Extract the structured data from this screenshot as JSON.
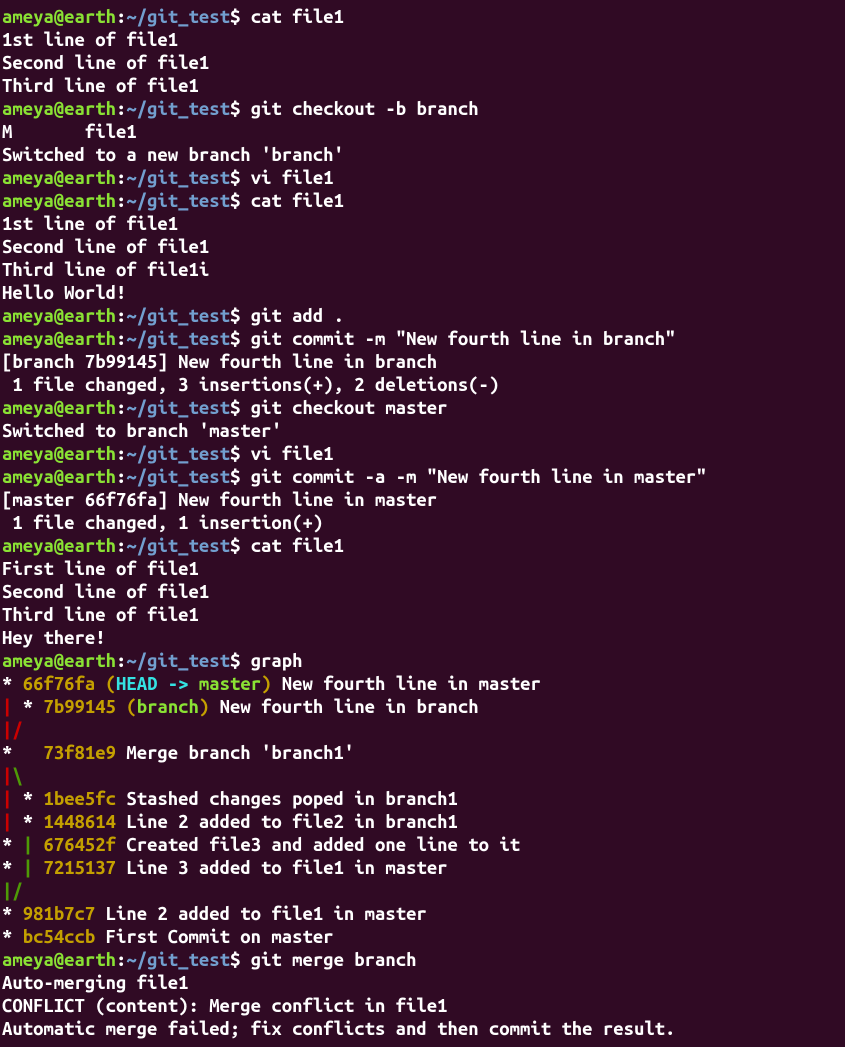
{
  "prompt": {
    "user": "ameya@earth",
    "colon": ":",
    "path": "~/git_test",
    "dollar": "$ "
  },
  "lines": [
    {
      "t": "prompt",
      "cmd": "cat file1"
    },
    {
      "t": "out",
      "text": "1st line of file1"
    },
    {
      "t": "out",
      "text": "Second line of file1"
    },
    {
      "t": "out",
      "text": "Third line of file1"
    },
    {
      "t": "prompt",
      "cmd": "git checkout -b branch"
    },
    {
      "t": "out",
      "text": "M       file1"
    },
    {
      "t": "out",
      "text": "Switched to a new branch 'branch'"
    },
    {
      "t": "prompt",
      "cmd": "vi file1"
    },
    {
      "t": "prompt",
      "cmd": "cat file1"
    },
    {
      "t": "out",
      "text": "1st line of file1"
    },
    {
      "t": "out",
      "text": "Second line of file1"
    },
    {
      "t": "out",
      "text": "Third line of file1i"
    },
    {
      "t": "out",
      "text": "Hello World!"
    },
    {
      "t": "prompt",
      "cmd": "git add ."
    },
    {
      "t": "prompt",
      "cmd": "git commit -m \"New fourth line in branch\""
    },
    {
      "t": "out",
      "text": "[branch 7b99145] New fourth line in branch"
    },
    {
      "t": "out",
      "text": " 1 file changed, 3 insertions(+), 2 deletions(-)"
    },
    {
      "t": "prompt",
      "cmd": "git checkout master"
    },
    {
      "t": "out",
      "text": "Switched to branch 'master'"
    },
    {
      "t": "prompt",
      "cmd": "vi file1"
    },
    {
      "t": "prompt",
      "cmd": "git commit -a -m \"New fourth line in master\""
    },
    {
      "t": "out",
      "text": "[master 66f76fa] New fourth line in master"
    },
    {
      "t": "out",
      "text": " 1 file changed, 1 insertion(+)"
    },
    {
      "t": "prompt",
      "cmd": "cat file1"
    },
    {
      "t": "out",
      "text": "First line of file1"
    },
    {
      "t": "out",
      "text": "Second line of file1"
    },
    {
      "t": "out",
      "text": "Third line of file1"
    },
    {
      "t": "out",
      "text": "Hey there!"
    },
    {
      "t": "prompt",
      "cmd": "graph"
    },
    {
      "t": "graph",
      "segs": [
        {
          "c": "graph-white",
          "v": "* "
        },
        {
          "c": "hash",
          "v": "66f76fa "
        },
        {
          "c": "paren-yellow",
          "v": "("
        },
        {
          "c": "head",
          "v": "HEAD -> "
        },
        {
          "c": "branchname",
          "v": "master"
        },
        {
          "c": "paren-yellow",
          "v": ")"
        },
        {
          "c": "out",
          "v": " New fourth line in master"
        }
      ]
    },
    {
      "t": "graph",
      "segs": [
        {
          "c": "graph-red",
          "v": "|"
        },
        {
          "c": "graph-white",
          "v": " * "
        },
        {
          "c": "hash",
          "v": "7b99145 "
        },
        {
          "c": "paren-yellow",
          "v": "("
        },
        {
          "c": "branchname",
          "v": "branch"
        },
        {
          "c": "paren-yellow",
          "v": ")"
        },
        {
          "c": "out",
          "v": " New fourth line in branch"
        }
      ]
    },
    {
      "t": "graph",
      "segs": [
        {
          "c": "graph-red",
          "v": "|"
        },
        {
          "c": "graph-red",
          "v": "/"
        }
      ]
    },
    {
      "t": "graph",
      "segs": [
        {
          "c": "graph-white",
          "v": "*   "
        },
        {
          "c": "hash",
          "v": "73f81e9"
        },
        {
          "c": "out",
          "v": " Merge branch 'branch1'"
        }
      ]
    },
    {
      "t": "graph",
      "segs": [
        {
          "c": "graph-red",
          "v": "|"
        },
        {
          "c": "graph-green",
          "v": "\\"
        }
      ]
    },
    {
      "t": "graph",
      "segs": [
        {
          "c": "graph-red",
          "v": "|"
        },
        {
          "c": "graph-white",
          "v": " * "
        },
        {
          "c": "hash",
          "v": "1bee5fc"
        },
        {
          "c": "out",
          "v": " Stashed changes poped in branch1"
        }
      ]
    },
    {
      "t": "graph",
      "segs": [
        {
          "c": "graph-red",
          "v": "|"
        },
        {
          "c": "graph-white",
          "v": " * "
        },
        {
          "c": "hash",
          "v": "1448614"
        },
        {
          "c": "out",
          "v": " Line 2 added to file2 in branch1"
        }
      ]
    },
    {
      "t": "graph",
      "segs": [
        {
          "c": "graph-white",
          "v": "* "
        },
        {
          "c": "graph-green",
          "v": "|"
        },
        {
          "c": "graph-white",
          "v": " "
        },
        {
          "c": "hash",
          "v": "676452f"
        },
        {
          "c": "out",
          "v": " Created file3 and added one line to it"
        }
      ]
    },
    {
      "t": "graph",
      "segs": [
        {
          "c": "graph-white",
          "v": "* "
        },
        {
          "c": "graph-green",
          "v": "|"
        },
        {
          "c": "graph-white",
          "v": " "
        },
        {
          "c": "hash",
          "v": "7215137"
        },
        {
          "c": "out",
          "v": " Line 3 added to file1 in master"
        }
      ]
    },
    {
      "t": "graph",
      "segs": [
        {
          "c": "graph-green",
          "v": "|"
        },
        {
          "c": "graph-green",
          "v": "/"
        }
      ]
    },
    {
      "t": "graph",
      "segs": [
        {
          "c": "graph-white",
          "v": "* "
        },
        {
          "c": "hash",
          "v": "981b7c7"
        },
        {
          "c": "out",
          "v": " Line 2 added to file1 in master"
        }
      ]
    },
    {
      "t": "graph",
      "segs": [
        {
          "c": "graph-white",
          "v": "* "
        },
        {
          "c": "hash",
          "v": "bc54ccb"
        },
        {
          "c": "out",
          "v": " First Commit on master"
        }
      ]
    },
    {
      "t": "prompt",
      "cmd": "git merge branch"
    },
    {
      "t": "out",
      "text": "Auto-merging file1"
    },
    {
      "t": "out",
      "text": "CONFLICT (content): Merge conflict in file1"
    },
    {
      "t": "out",
      "text": "Automatic merge failed; fix conflicts and then commit the result."
    }
  ]
}
